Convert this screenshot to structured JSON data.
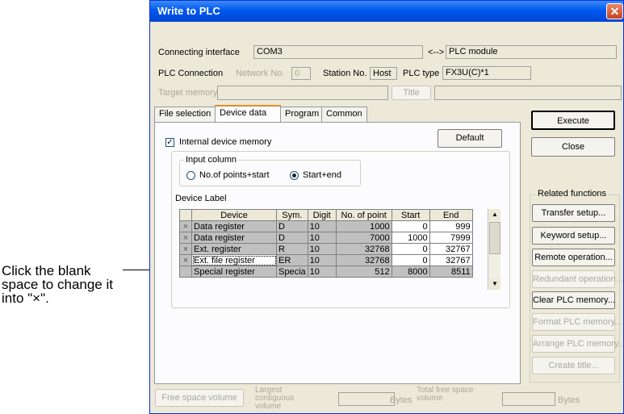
{
  "callout": {
    "text": "Click the blank space to change it into \"×\"."
  },
  "window": {
    "title": "Write to PLC",
    "close_glyph": "✕"
  },
  "connection": {
    "interface_label": "Connecting interface",
    "interface_value": "COM3",
    "arrow": "<-->",
    "module_value": "PLC module",
    "plc_connection_label": "PLC Connection",
    "network_label": "Network No.",
    "network_value": "0",
    "station_label": "Station No.",
    "station_value": "Host",
    "plc_type_label": "PLC type",
    "plc_type_value": "FX3U(C)*1",
    "target_memory_label": "Target memory",
    "title_button": "Title"
  },
  "tabs": [
    "File selection",
    "Device data",
    "Program",
    "Common"
  ],
  "device_data": {
    "internal_memory_label": "Internal device memory",
    "internal_memory_checked": true,
    "default_button": "Default",
    "input_column": {
      "title": "Input column",
      "options": [
        "No.of points+start",
        "Start+end"
      ],
      "selected": "Start+end"
    },
    "device_label_title": "Device Label",
    "columns": [
      "Device",
      "Sym.",
      "Digit",
      "No. of point",
      "Start",
      "End"
    ],
    "rows": [
      {
        "mark": "×",
        "device": "Data register",
        "sym": "D",
        "digit": "10",
        "points": "1000",
        "start": "0",
        "end": "999"
      },
      {
        "mark": "×",
        "device": "Data register",
        "sym": "D",
        "digit": "10",
        "points": "7000",
        "start": "1000",
        "end": "7999"
      },
      {
        "mark": "×",
        "device": "Ext. register",
        "sym": "R",
        "digit": "10",
        "points": "32768",
        "start": "0",
        "end": "32767"
      },
      {
        "mark": "×",
        "device": "Ext. file register",
        "sym": "ER",
        "digit": "10",
        "points": "32768",
        "start": "0",
        "end": "32767"
      },
      {
        "mark": "",
        "device": "Special register",
        "sym": "Specia",
        "digit": "10",
        "points": "512",
        "start": "8000",
        "end": "8511"
      }
    ]
  },
  "buttons": {
    "execute": "Execute",
    "close": "Close"
  },
  "related": {
    "title": "Related functions",
    "items": [
      {
        "label": "Transfer setup...",
        "enabled": true
      },
      {
        "label": "Keyword setup...",
        "enabled": true
      },
      {
        "label": "Remote operation...",
        "enabled": true
      },
      {
        "label": "Redundant operation...",
        "enabled": false
      },
      {
        "label": "Clear PLC memory...",
        "enabled": true
      },
      {
        "label": "Format PLC memory...",
        "enabled": false
      },
      {
        "label": "Arrange PLC memory...",
        "enabled": false
      },
      {
        "label": "Create title...",
        "enabled": false
      }
    ]
  },
  "footer": {
    "free_space_button": "Free space volume",
    "largest_label": "Largest contiguous volume",
    "bytes1": "Bytes",
    "total_label": "Total free space volume",
    "bytes2": "Bytes"
  }
}
